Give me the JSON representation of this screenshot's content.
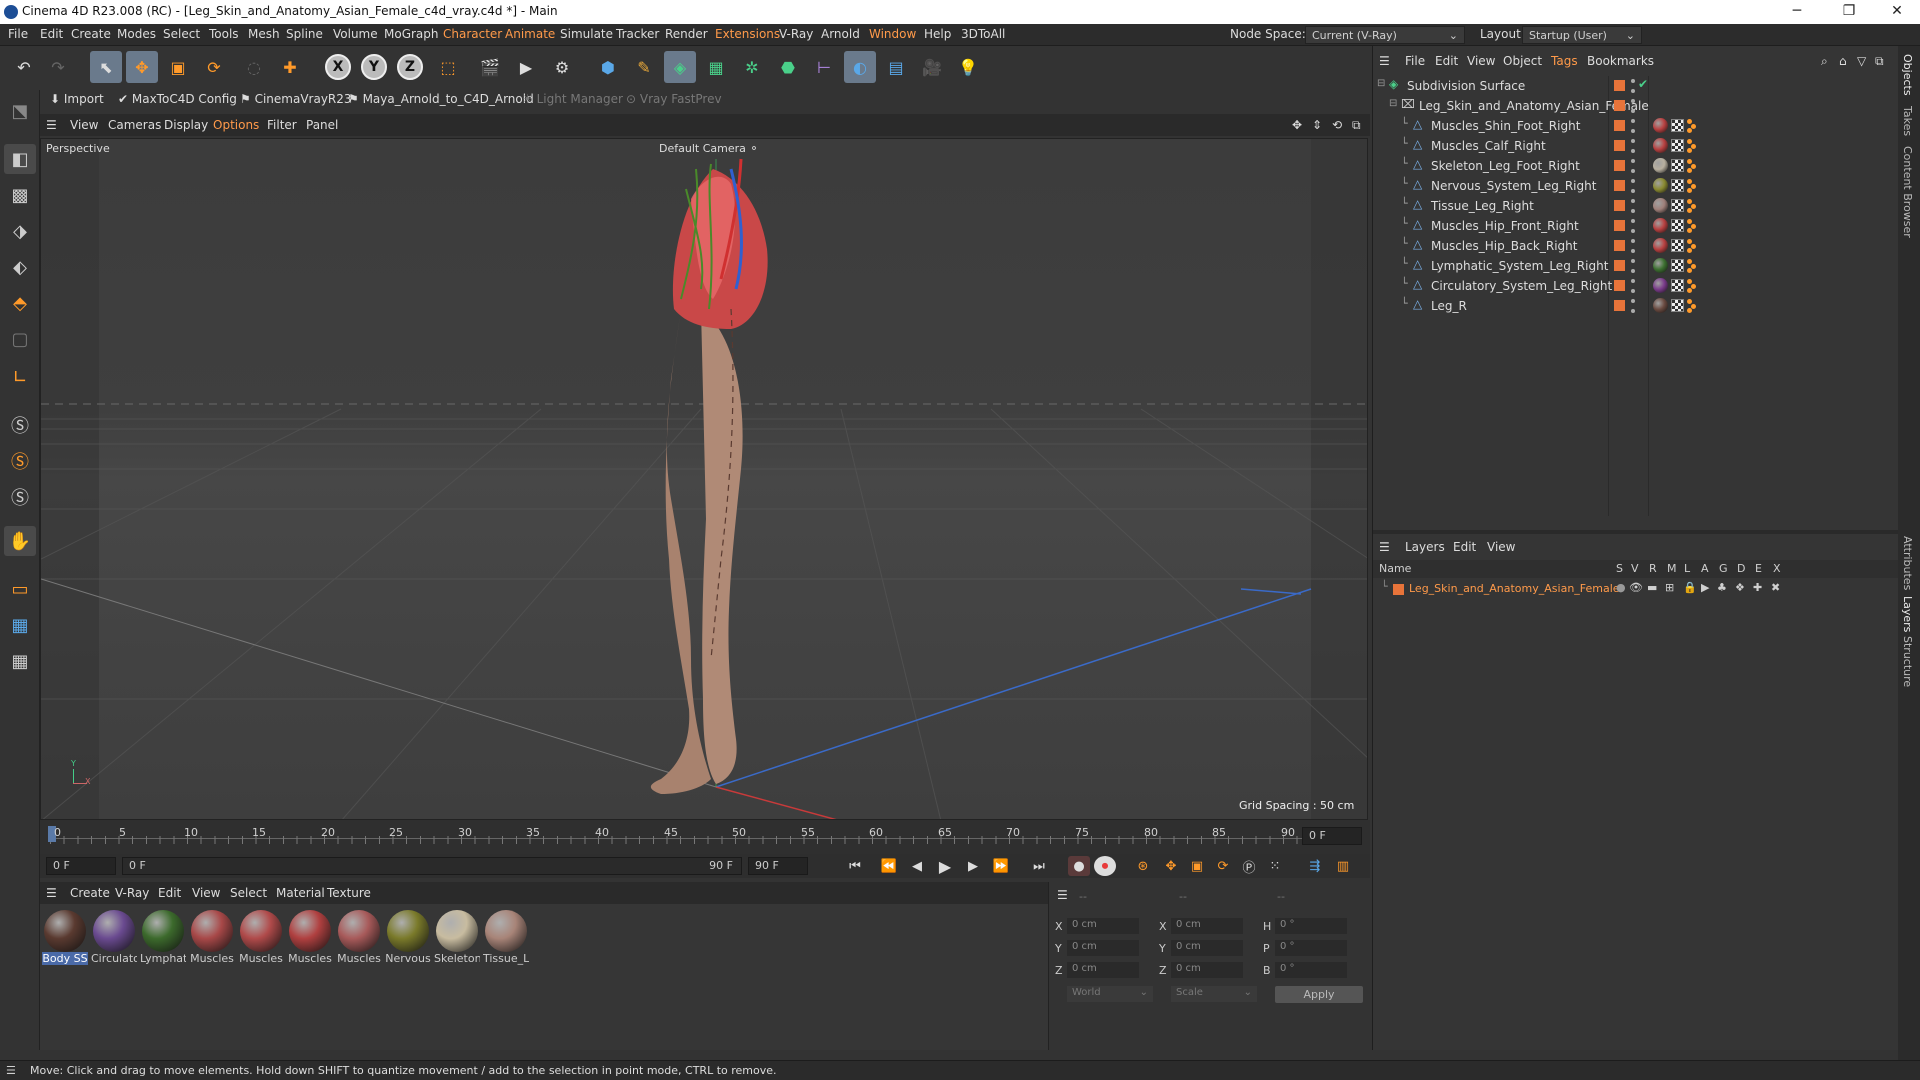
{
  "window": {
    "title": "Cinema 4D R23.008 (RC) - [Leg_Skin_and_Anatomy_Asian_Female_c4d_vray.c4d *] - Main",
    "buttons": [
      "─",
      "❐",
      "✕"
    ]
  },
  "menubar": {
    "items": [
      "File",
      "Edit",
      "Create",
      "Modes",
      "Select",
      "Tools",
      "Mesh",
      "Spline",
      "Volume",
      "MoGraph",
      "Character",
      "Animate",
      "Simulate",
      "Tracker",
      "Render",
      "Extensions",
      "V-Ray",
      "Arnold",
      "Window",
      "Help",
      "3DToAll"
    ],
    "node_space_label": "Node Space:",
    "node_space_value": "Current (V-Ray)",
    "layout_label": "Layout:",
    "layout_value": "Startup (User)"
  },
  "plugin_bar": {
    "items": [
      "Import",
      "MaxToC4D Config",
      "CinemaVrayR23",
      "Maya_Arnold_to_C4D_Arnold",
      "Light Manager",
      "Vray FastPrev"
    ]
  },
  "viewport": {
    "menu": [
      "View",
      "Cameras",
      "Display",
      "Options",
      "Filter",
      "Panel"
    ],
    "label": "Perspective",
    "camera": "Default Camera",
    "camera_icon": "camera-icon",
    "grid_spacing": "Grid Spacing : 50 cm",
    "axis_y": "Y",
    "axis_x": "X"
  },
  "timeline": {
    "ticks": [
      "0",
      "5",
      "10",
      "15",
      "20",
      "25",
      "30",
      "35",
      "40",
      "45",
      "50",
      "55",
      "60",
      "65",
      "70",
      "75",
      "80",
      "85",
      "90"
    ],
    "current_frame": "0 F",
    "field_start": "0 F",
    "field_range": "0 F",
    "field_end_a": "90 F",
    "field_end_b": "90 F"
  },
  "materials": {
    "menu": [
      "Create",
      "V-Ray",
      "Edit",
      "View",
      "Select",
      "Material",
      "Texture"
    ],
    "items": [
      {
        "label": "Body SS",
        "color": "#5a3a30"
      },
      {
        "label": "Circulato",
        "color": "#6a4a90"
      },
      {
        "label": "Lymphat",
        "color": "#3c6a2c"
      },
      {
        "label": "Muscles",
        "color": "#a84848"
      },
      {
        "label": "Muscles",
        "color": "#b04a4a"
      },
      {
        "label": "Muscles",
        "color": "#b04040"
      },
      {
        "label": "Muscles",
        "color": "#a85a5a"
      },
      {
        "label": "Nervous",
        "color": "#7a7a2a"
      },
      {
        "label": "Skeleton",
        "color": "#c8bca0"
      },
      {
        "label": "Tissue_L",
        "color": "#a88478"
      }
    ]
  },
  "coords": {
    "header": [
      "--",
      "--",
      "--"
    ],
    "rows": [
      {
        "a": "X",
        "av": "0 cm",
        "b": "X",
        "bv": "0 cm",
        "c": "H",
        "cv": "0 °"
      },
      {
        "a": "Y",
        "av": "0 cm",
        "b": "Y",
        "bv": "0 cm",
        "c": "P",
        "cv": "0 °"
      },
      {
        "a": "Z",
        "av": "0 cm",
        "b": "Z",
        "bv": "0 cm",
        "c": "B",
        "cv": "0 °"
      }
    ],
    "mode1": "World",
    "mode2": "Scale",
    "apply": "Apply"
  },
  "objects": {
    "menu": [
      "File",
      "Edit",
      "View",
      "Object",
      "Tags",
      "Bookmarks"
    ],
    "root": "Subdivision Surface",
    "group": "Leg_Skin_and_Anatomy_Asian_Female",
    "items": [
      {
        "name": "Muscles_Shin_Foot_Right",
        "ball": "#b84040"
      },
      {
        "name": "Muscles_Calf_Right",
        "ball": "#b84040"
      },
      {
        "name": "Skeleton_Leg_Foot_Right",
        "ball": "#b8b0a0"
      },
      {
        "name": "Nervous_System_Leg_Right",
        "ball": "#8a8a30"
      },
      {
        "name": "Tissue_Leg_Right",
        "ball": "#a0807a"
      },
      {
        "name": "Muscles_Hip_Front_Right",
        "ball": "#b84040"
      },
      {
        "name": "Muscles_Hip_Back_Right",
        "ball": "#b84040"
      },
      {
        "name": "Lymphatic_System_Leg_Right",
        "ball": "#3c7030"
      },
      {
        "name": "Circulatory_System_Leg_Right",
        "ball": "#7a3a8a"
      },
      {
        "name": "Leg_R",
        "ball": "#6a4a40"
      }
    ]
  },
  "layers": {
    "menu": [
      "Layers",
      "Edit",
      "View"
    ],
    "columns": [
      "Name",
      "S",
      "V",
      "R",
      "M",
      "L",
      "A",
      "G",
      "D",
      "E",
      "X"
    ],
    "rows": [
      {
        "name": "Leg_Skin_and_Anatomy_Asian_Female",
        "color": "#e8743a"
      }
    ]
  },
  "right_tabs": [
    "Objects",
    "Takes",
    "Content Browser",
    "Attributes",
    "Layers",
    "Structure"
  ],
  "status": "Move: Click and drag to move elements. Hold down SHIFT to quantize movement / add to the selection in point mode, CTRL to remove."
}
